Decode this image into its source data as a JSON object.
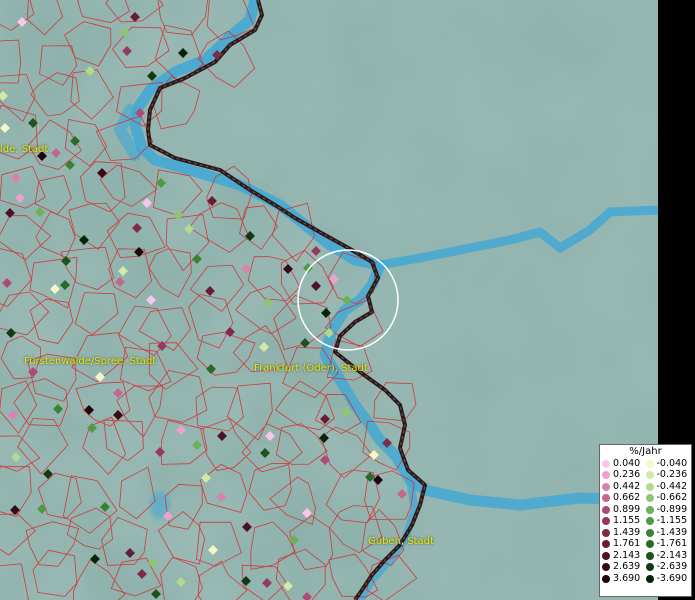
{
  "map": {
    "places": [
      {
        "label": "lde, Stadt"
      },
      {
        "label": "Fürstenwalde/Spree, Stadt"
      },
      {
        "label": "Frankfurt (Oder), Stadt"
      },
      {
        "label": "Guben, Stadt"
      }
    ],
    "colors": {
      "land": "#8aaea8",
      "river": "#3fa7d6",
      "borders": "#d8262a",
      "national_border": "#2a1a1a",
      "label": "#e8e800"
    }
  },
  "legend": {
    "title": "%/Jahr",
    "positive": [
      {
        "value": "0.040",
        "color": "#f7c6ea"
      },
      {
        "value": "0.236",
        "color": "#e9a3cc"
      },
      {
        "value": "0.442",
        "color": "#d882ad"
      },
      {
        "value": "0.662",
        "color": "#c56690"
      },
      {
        "value": "0.899",
        "color": "#ad4b74"
      },
      {
        "value": "1.155",
        "color": "#953a5e"
      },
      {
        "value": "1.439",
        "color": "#7e2a49"
      },
      {
        "value": "1.761",
        "color": "#671d38"
      },
      {
        "value": "2.143",
        "color": "#4e1228"
      },
      {
        "value": "2.639",
        "color": "#37091a"
      },
      {
        "value": "3.690",
        "color": "#200308"
      }
    ],
    "negative": [
      {
        "value": "-0.040",
        "color": "#f3f8c6"
      },
      {
        "value": "-0.236",
        "color": "#d2eaa6"
      },
      {
        "value": "-0.442",
        "color": "#b1db8c"
      },
      {
        "value": "-0.662",
        "color": "#8ec672"
      },
      {
        "value": "-0.899",
        "color": "#6cb05a"
      },
      {
        "value": "-1.155",
        "color": "#4f9a45"
      },
      {
        "value": "-1.439",
        "color": "#3a8236"
      },
      {
        "value": "-1.761",
        "color": "#2a6a29"
      },
      {
        "value": "-2.143",
        "color": "#1d531d"
      },
      {
        "value": "-2.639",
        "color": "#103b12"
      },
      {
        "value": "-3.690",
        "color": "#062408"
      }
    ]
  }
}
